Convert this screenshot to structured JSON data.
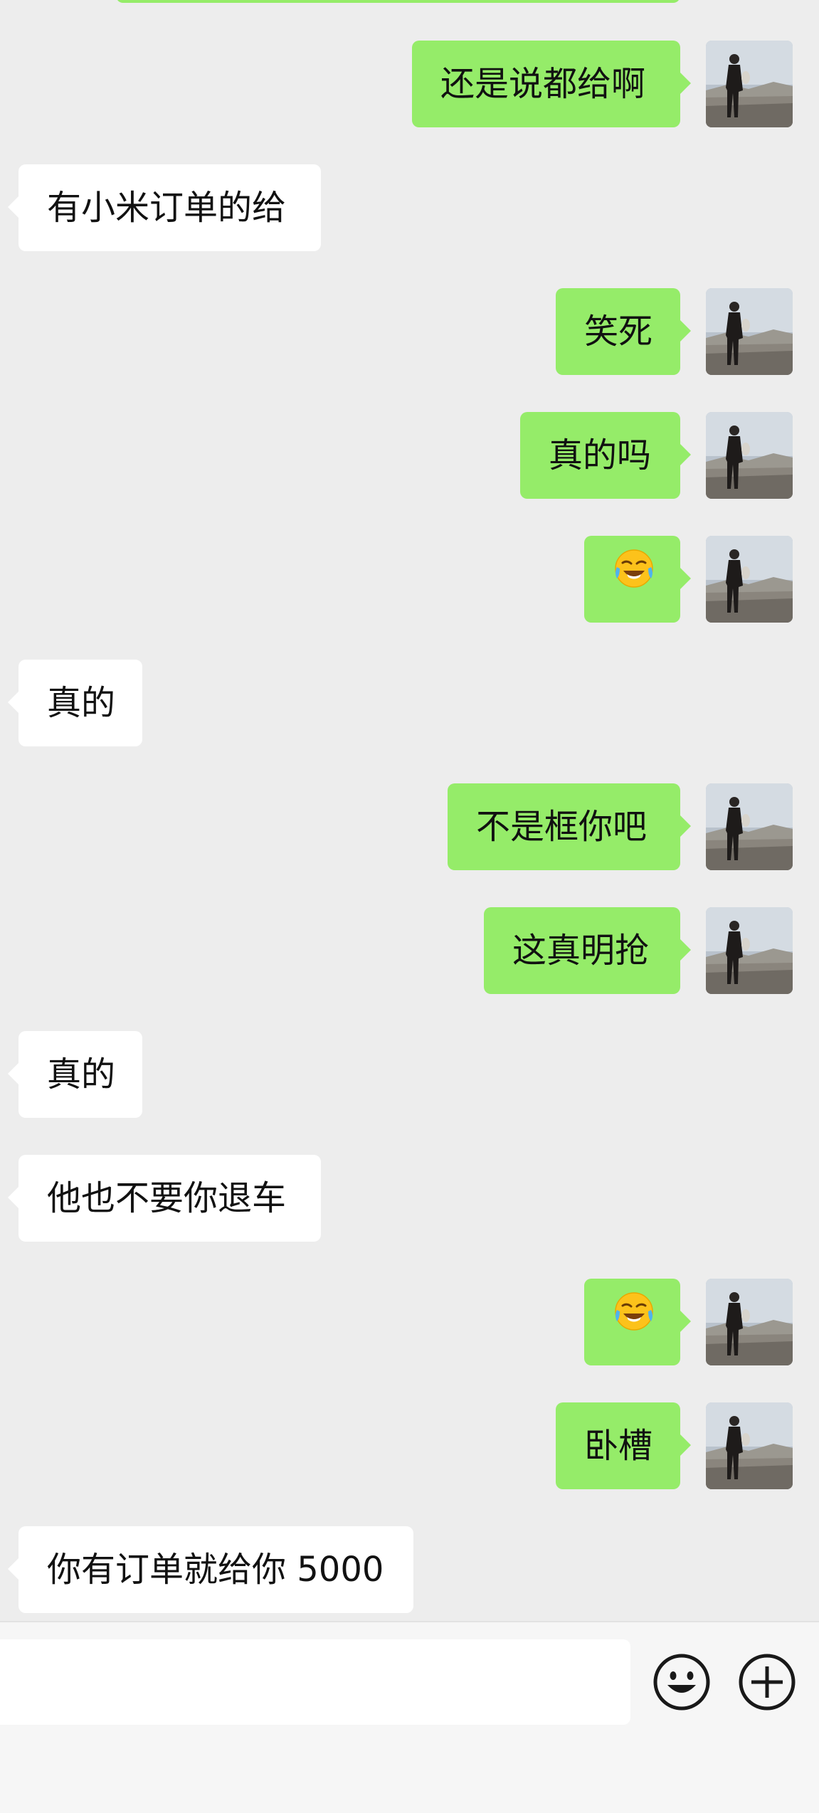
{
  "messages": [
    {
      "side": "right",
      "text": "还是说都给啊"
    },
    {
      "side": "left",
      "text": "有小米订单的给"
    },
    {
      "side": "right",
      "text": "笑死"
    },
    {
      "side": "right",
      "text": "真的吗"
    },
    {
      "side": "right",
      "emoji": "face-with-tears-of-joy"
    },
    {
      "side": "left",
      "text": "真的"
    },
    {
      "side": "right",
      "text": "不是框你吧"
    },
    {
      "side": "right",
      "text": "这真明抢"
    },
    {
      "side": "left",
      "text": "真的"
    },
    {
      "side": "left",
      "text": "他也不要你退车"
    },
    {
      "side": "right",
      "emoji": "face-with-tears-of-joy"
    },
    {
      "side": "right",
      "text": "卧槽"
    },
    {
      "side": "left",
      "text": "你有订单就给你 5000"
    }
  ],
  "input": {
    "value": ""
  },
  "icons": {
    "emoji_button": "smiley-face-icon",
    "more_button": "plus-circle-icon"
  },
  "colors": {
    "background": "#ededed",
    "sent_bubble": "#95ec69",
    "received_bubble": "#ffffff",
    "input_bar": "#f6f6f6"
  }
}
